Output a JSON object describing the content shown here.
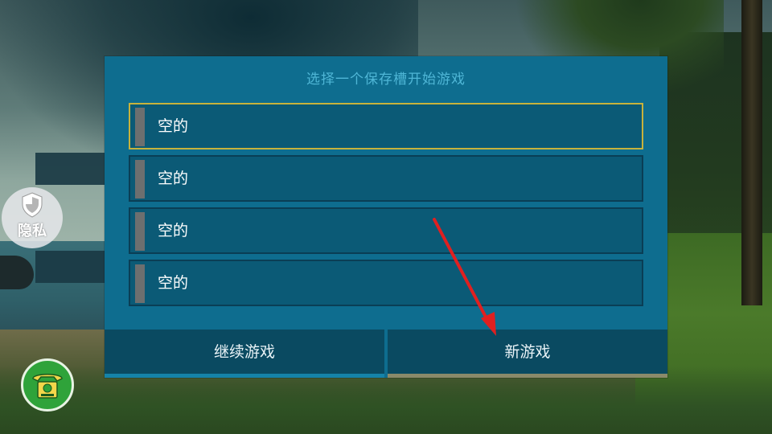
{
  "dialog": {
    "title": "选择一个保存槽开始游戏",
    "slots": [
      {
        "label": "空的",
        "selected": true
      },
      {
        "label": "空的",
        "selected": false
      },
      {
        "label": "空的",
        "selected": false
      },
      {
        "label": "空的",
        "selected": false
      }
    ],
    "continue_label": "继续游戏",
    "new_game_label": "新游戏"
  },
  "privacy_button": {
    "label": "隐私",
    "icon": "shield-icon"
  },
  "phone_button": {
    "icon": "telephone-icon"
  },
  "colors": {
    "dialog_bg": "#0e6d8f",
    "slot_bg": "#0b5a76",
    "selected_border": "#c7b23c",
    "title_text": "#4fb6d6",
    "annotation_arrow": "#e02020",
    "phone_bg": "#2fa33a"
  }
}
